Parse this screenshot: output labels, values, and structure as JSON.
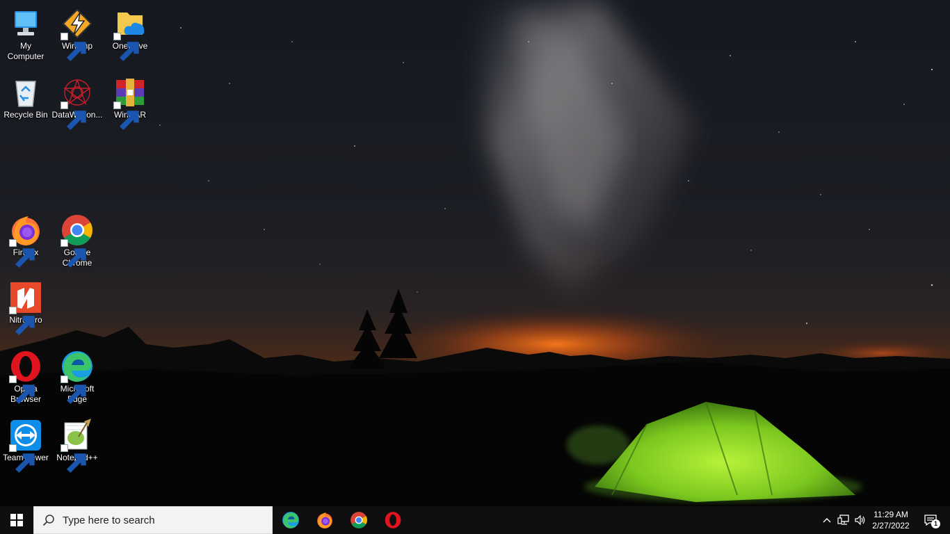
{
  "desktop": {
    "icons": [
      {
        "label": "My\nComputer",
        "icon": "computer-icon"
      },
      {
        "label": "Winamp",
        "icon": "winamp-icon"
      },
      {
        "label": "OneDrive",
        "icon": "onedrive-icon"
      },
      {
        "label": "Recycle Bin",
        "icon": "recycle-bin-icon"
      },
      {
        "label": "DataWagon...",
        "icon": "datawagon-icon"
      },
      {
        "label": "WinRAR",
        "icon": "winrar-icon"
      },
      {
        "label": "Firefox",
        "icon": "firefox-icon"
      },
      {
        "label": "Google\nChrome",
        "icon": "chrome-icon"
      },
      {
        "label": "Nitro Pro",
        "icon": "nitro-pro-icon"
      },
      {
        "label": "Opera\nBrowser",
        "icon": "opera-icon"
      },
      {
        "label": "Microsoft\nEdge",
        "icon": "edge-icon"
      },
      {
        "label": "TeamViewer",
        "icon": "teamviewer-icon"
      },
      {
        "label": "Notepad++",
        "icon": "notepad-plus-plus-icon"
      }
    ]
  },
  "taskbar": {
    "search_placeholder": "Type here to search",
    "pinned": [
      "Microsoft Edge",
      "Firefox",
      "Google Chrome",
      "Opera Browser"
    ],
    "clock_time": "11:29 AM",
    "clock_date": "2/27/2022",
    "notification_count": "1"
  },
  "colors": {
    "taskbar_bg": "#0f0f10",
    "tent_green": "#8fdc2a",
    "horizon_glow": "#e8641c"
  }
}
